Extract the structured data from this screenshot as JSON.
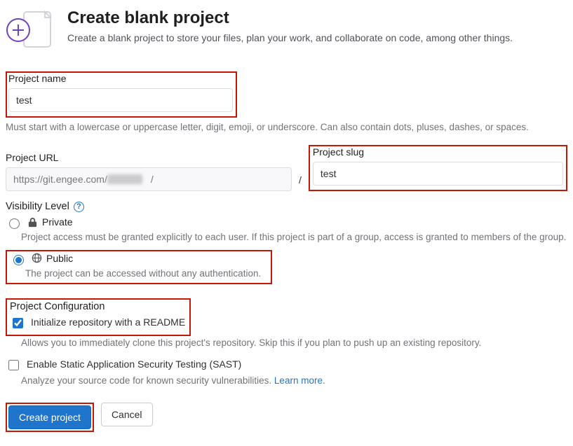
{
  "header": {
    "title": "Create blank project",
    "description": "Create a blank project to store your files, plan your work, and collaborate on code, among other things."
  },
  "name_field": {
    "label": "Project name",
    "value": "test",
    "help": "Must start with a lowercase or uppercase letter, digit, emoji, or underscore. Can also contain dots, pluses, dashes, or spaces."
  },
  "url_field": {
    "label": "Project URL",
    "base": "https://git.engee.com/",
    "separator": "/"
  },
  "slug_field": {
    "label": "Project slug",
    "value": "test"
  },
  "visibility": {
    "label": "Visibility Level",
    "private": {
      "title": "Private",
      "desc": "Project access must be granted explicitly to each user. If this project is part of a group, access is granted to members of the group."
    },
    "public": {
      "title": "Public",
      "desc": "The project can be accessed without any authentication."
    }
  },
  "config": {
    "heading": "Project Configuration",
    "readme": {
      "label": "Initialize repository with a README",
      "desc": "Allows you to immediately clone this project's repository. Skip this if you plan to push up an existing repository."
    },
    "sast": {
      "label": "Enable Static Application Security Testing (SAST)",
      "desc_prefix": "Analyze your source code for known security vulnerabilities. ",
      "learn_more": "Learn more",
      "dot": "."
    }
  },
  "buttons": {
    "create": "Create project",
    "cancel": "Cancel"
  }
}
